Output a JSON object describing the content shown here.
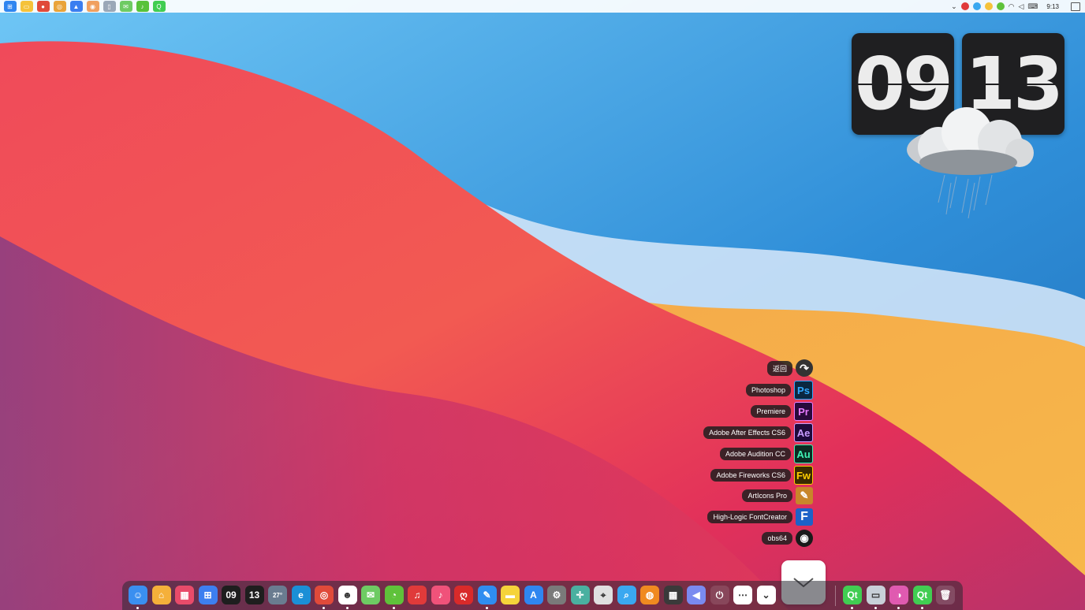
{
  "taskbar": {
    "left_icons": [
      "windows-icon",
      "file-explorer-icon",
      "netease-icon",
      "chrome-icon",
      "teams-icon",
      "obs-icon",
      "tablet-icon",
      "wechat-icon",
      "music-icon",
      "qt-icon"
    ],
    "time": "9:13"
  },
  "clock": {
    "hours": "09",
    "minutes": "13"
  },
  "stack_items": [
    {
      "label": "返回",
      "icon_text": "↷",
      "bg": "#333333",
      "fg": "#ffffff"
    },
    {
      "label": "Photoshop",
      "icon_text": "Ps",
      "bg": "#0b2740",
      "fg": "#31a8ff"
    },
    {
      "label": "Premiere",
      "icon_text": "Pr",
      "bg": "#2a0a3b",
      "fg": "#e77bff"
    },
    {
      "label": "Adobe After Effects CS6",
      "icon_text": "Ae",
      "bg": "#1e0a3b",
      "fg": "#c89cff"
    },
    {
      "label": "Adobe Audition CC",
      "icon_text": "Au",
      "bg": "#0a2b22",
      "fg": "#3ff2b4"
    },
    {
      "label": "Adobe Fireworks CS6",
      "icon_text": "Fw",
      "bg": "#3a2a00",
      "fg": "#ffcc00"
    },
    {
      "label": "ArtIcons Pro",
      "icon_text": "✎",
      "bg": "#c8862a",
      "fg": "#ffffff"
    },
    {
      "label": "High-Logic FontCreator",
      "icon_text": "F",
      "bg": "#1c62c8",
      "fg": "#ffffff"
    },
    {
      "label": "obs64",
      "icon_text": "◉",
      "bg": "#1a1a1a",
      "fg": "#ffffff"
    }
  ],
  "dock": {
    "items": [
      {
        "name": "finder-icon",
        "text": "☺",
        "bg": "#3a8ff0",
        "dot": true
      },
      {
        "name": "home-icon",
        "text": "⌂",
        "bg": "#f5b03a",
        "dot": false
      },
      {
        "name": "launchpad-icon",
        "text": "▦",
        "bg": "#e84b6a",
        "dot": false
      },
      {
        "name": "windows-start-icon",
        "text": "⊞",
        "bg": "#3d7ff0",
        "dot": false
      },
      {
        "name": "clock-hour-icon",
        "text": "09",
        "bg": "#1e1e1e",
        "dot": false
      },
      {
        "name": "clock-minute-icon",
        "text": "13",
        "bg": "#1e1e1e",
        "dot": false
      },
      {
        "name": "weather-icon",
        "text": "27°",
        "bg": "#6a7c90",
        "dot": false
      },
      {
        "name": "edge-icon",
        "text": "e",
        "bg": "#1b8fd6",
        "dot": false
      },
      {
        "name": "chrome-icon",
        "text": "◎",
        "bg": "#e04a3a",
        "dot": true
      },
      {
        "name": "qq-icon",
        "text": "☻",
        "bg": "#ffffff",
        "dot": true
      },
      {
        "name": "wechat-icon",
        "text": "✉",
        "bg": "#6ecb63",
        "dot": false
      },
      {
        "name": "pie-app-icon",
        "text": "◔",
        "bg": "#5fc23a",
        "dot": true
      },
      {
        "name": "netease-music-icon",
        "text": "♫",
        "bg": "#e03a3a",
        "dot": false
      },
      {
        "name": "itunes-icon",
        "text": "♪",
        "bg": "#f0527a",
        "dot": false
      },
      {
        "name": "red-swirl-icon",
        "text": "ღ",
        "bg": "#d92a2a",
        "dot": false
      },
      {
        "name": "pen-icon",
        "text": "✎",
        "bg": "#2f8df0",
        "dot": true
      },
      {
        "name": "notes-icon",
        "text": "▬",
        "bg": "#f5d33a",
        "dot": false
      },
      {
        "name": "app-store-icon",
        "text": "A",
        "bg": "#2f86f0",
        "dot": false
      },
      {
        "name": "settings-icon",
        "text": "⚙",
        "bg": "#7a7a7a",
        "dot": false
      },
      {
        "name": "color-picker-icon",
        "text": "✛",
        "bg": "#4ab0a0",
        "dot": false
      },
      {
        "name": "screenshot-icon",
        "text": "⌖",
        "bg": "#e0e0e0",
        "dot": false
      },
      {
        "name": "magnifier-icon",
        "text": "⌕",
        "bg": "#3aa8f0",
        "dot": false
      },
      {
        "name": "orange-ring-icon",
        "text": "◍",
        "bg": "#f08a20",
        "dot": false
      },
      {
        "name": "calculator-icon",
        "text": "▦",
        "bg": "#3a3a3a",
        "dot": false
      },
      {
        "name": "volume-icon",
        "text": "◀",
        "bg": "#7a8af0",
        "dot": false
      },
      {
        "name": "power-icon",
        "text": "⏻",
        "bg": "rgba(255,255,255,0.12)",
        "dot": false
      },
      {
        "name": "more-icon",
        "text": "⋯",
        "bg": "#ffffff",
        "dot": false
      },
      {
        "name": "stack-chevron-icon",
        "text": "⌄",
        "bg": "#ffffff",
        "dot": false
      }
    ],
    "right_items": [
      {
        "name": "qt-icon",
        "text": "Qt",
        "bg": "#41cd52",
        "dot": true
      },
      {
        "name": "display-icon",
        "text": "▭",
        "bg": "#c8d0d8",
        "dot": true
      },
      {
        "name": "color-wheel-icon",
        "text": "◑",
        "bg": "#e05ab0",
        "dot": true
      },
      {
        "name": "qt-creator-icon",
        "text": "Qt",
        "bg": "#41cd52",
        "dot": true
      },
      {
        "name": "trash-icon",
        "text": "🗑",
        "bg": "rgba(255,255,255,0.15)",
        "dot": false
      }
    ]
  }
}
